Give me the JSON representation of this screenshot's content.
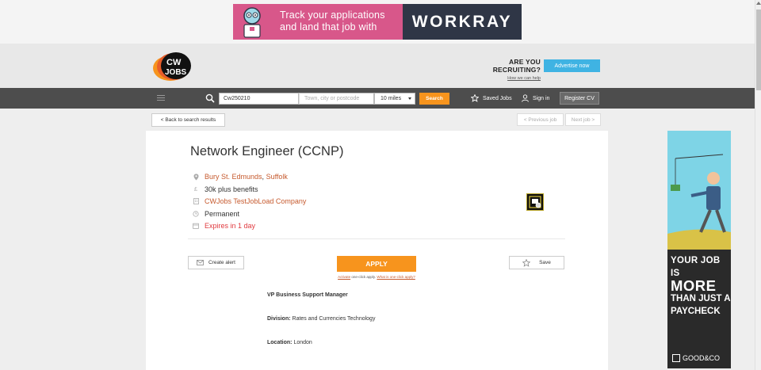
{
  "top_ad": {
    "line1": "Track your applications",
    "line2": "and land that job with",
    "brand": "WORKRAY",
    "colors": {
      "left": "#d8578a",
      "right": "#2f3646"
    }
  },
  "header": {
    "logo_text_1": "CW",
    "logo_text_2": "JOBS",
    "recruiting_question": "ARE YOU RECRUITING?",
    "how_link": "How we can help",
    "advertise_label": "Advertise now"
  },
  "nav": {
    "keywords_value": "Cw250210",
    "location_placeholder": "Town, city or postcode",
    "radius_value": "10 miles",
    "search_label": "Search",
    "saved_jobs_label": "Saved Jobs",
    "sign_in_label": "Sign in",
    "register_label": "Register CV"
  },
  "pager": {
    "back_label": "< Back to search results",
    "previous_label": "< Previous job",
    "next_label": "Next job >"
  },
  "job": {
    "title": "Network Engineer (CCNP)",
    "location_town": "Bury St. Edmunds",
    "location_separator": ",",
    "location_county": "Suffolk",
    "salary": "30k plus benefits",
    "company": "CWJobs TestJobLoad Company",
    "job_type": "Permanent",
    "expires": "Expires in 1 day"
  },
  "actions": {
    "create_alert_label": "Create alert",
    "apply_label": "APPLY",
    "activate_link": "Activate",
    "one_click_text": "one-click apply.",
    "what_is_link": "What is one-click apply?",
    "save_label": "Save"
  },
  "description": {
    "heading": "VP Business Support Manager",
    "division_label": "Division:",
    "division_value": "Rates and Currencies Technology",
    "location_label": "Location:",
    "location_value": "London"
  },
  "side_ad": {
    "line1": "YOUR JOB IS",
    "line2": "MORE",
    "line3": "THAN JUST A",
    "line4": "PAYCHECK",
    "brand": "GOOD&CO"
  },
  "colors": {
    "accent_orange": "#f7941d",
    "link": "#c65a2e",
    "expiry_red": "#e0393e",
    "nav_bg": "#4d4d4d",
    "advertise_blue": "#3fb3e3"
  }
}
